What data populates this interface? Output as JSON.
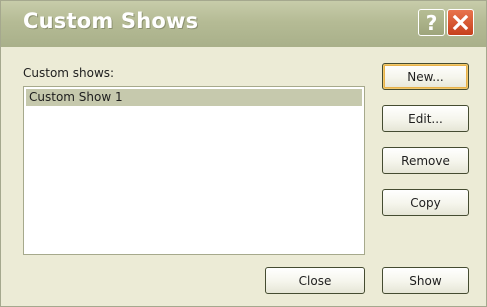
{
  "window": {
    "title": "Custom Shows",
    "help_glyph": "?"
  },
  "list": {
    "label": "Custom shows:",
    "items": [
      "Custom Show 1"
    ]
  },
  "buttons": {
    "new": "New...",
    "edit": "Edit...",
    "remove": "Remove",
    "copy": "Copy",
    "close": "Close",
    "show": "Show"
  },
  "colors": {
    "titlebar": "#b5bb95",
    "dialog_bg": "#ecebd6",
    "selection": "#c6c9ad",
    "close_button": "#d9562f"
  },
  "icons": {
    "help": "help-icon",
    "close": "close-icon"
  }
}
